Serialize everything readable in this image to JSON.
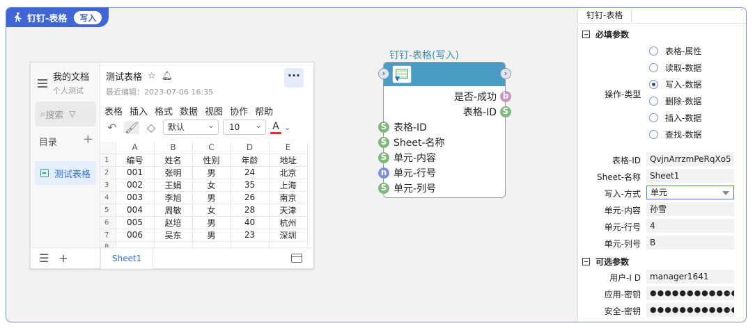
{
  "header": {
    "title": "钉钉-表格",
    "mode": "写入"
  },
  "mock_app": {
    "doc_title": "我的文档",
    "doc_sub": "个人测试",
    "search_label": "搜索",
    "toc_label": "目录",
    "sheet_item": "测试表格",
    "main_title": "测试表格",
    "last_edit": "最近编辑：2023-07-06 16:35",
    "menu": [
      "表格",
      "插入",
      "格式",
      "数据",
      "视图",
      "协作",
      "帮助"
    ],
    "font": "默认",
    "font_size": "10",
    "color_label": "A",
    "more_label": "···",
    "sheet_tab": "Sheet1",
    "columns": [
      "A",
      "B",
      "C",
      "D",
      "E"
    ],
    "rows": [
      [
        "1",
        "编号",
        "姓名",
        "性别",
        "年龄",
        "地址"
      ],
      [
        "2",
        "001",
        "张明",
        "男",
        "24",
        "北京"
      ],
      [
        "3",
        "002",
        "王娟",
        "女",
        "35",
        "上海"
      ],
      [
        "4",
        "003",
        "李旭",
        "男",
        "26",
        "南京"
      ],
      [
        "5",
        "004",
        "周敏",
        "女",
        "28",
        "天津"
      ],
      [
        "6",
        "005",
        "赵培",
        "男",
        "40",
        "杭州"
      ],
      [
        "7",
        "006",
        "吴东",
        "男",
        "23",
        "深圳"
      ],
      [
        "8",
        "",
        "",
        "",
        "",
        ""
      ]
    ]
  },
  "node": {
    "title": "钉钉-表格(写入)",
    "outputs": [
      {
        "label": "是否-成功",
        "type": "b"
      },
      {
        "label": "表格-ID",
        "type": "S"
      }
    ],
    "inputs": [
      {
        "label": "表格-ID",
        "type": "S"
      },
      {
        "label": "Sheet-名称",
        "type": "S"
      },
      {
        "label": "单元-内容",
        "type": "S"
      },
      {
        "label": "单元-行号",
        "type": "n"
      },
      {
        "label": "单元-列号",
        "type": "S"
      }
    ]
  },
  "panel": {
    "tab": "钉钉-表格",
    "required_title": "必填参数",
    "operation_label": "操作-类型",
    "operations": [
      {
        "label": "表格-属性",
        "selected": false
      },
      {
        "label": "读取-数据",
        "selected": false
      },
      {
        "label": "写入-数据",
        "selected": true
      },
      {
        "label": "删除-数据",
        "selected": false
      },
      {
        "label": "插入-数据",
        "selected": false
      },
      {
        "label": "查找-数据",
        "selected": false
      }
    ],
    "fields": [
      {
        "label": "表格-ID",
        "value": "QvjnArrzmPeRqXo5"
      },
      {
        "label": "Sheet-名称",
        "value": "Sheet1"
      },
      {
        "label": "写入-方式",
        "value": "单元"
      },
      {
        "label": "单元-内容",
        "value": "孙雪"
      },
      {
        "label": "单元-行号",
        "value": "4"
      },
      {
        "label": "单元-列号",
        "value": "B"
      }
    ],
    "optional_title": "可选参数",
    "optional_fields": [
      {
        "label": "用户-I D",
        "value": "manager1641"
      },
      {
        "label": "应用-密钥",
        "value": "●●●●●●●●●●●●"
      },
      {
        "label": "安全-密钥",
        "value": "●●●●●●●●●●●●"
      }
    ]
  }
}
